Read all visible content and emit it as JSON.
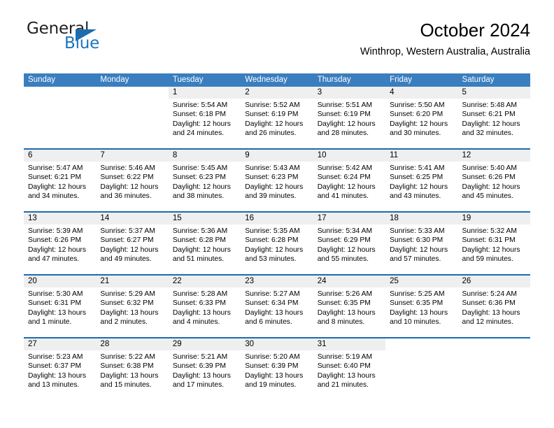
{
  "brand": {
    "name_part1": "General",
    "name_part2": "Blue",
    "icon": "triangle-logo-icon",
    "color_dark": "#231f20",
    "color_blue": "#1b75bb"
  },
  "header": {
    "title": "October 2024",
    "subtitle": "Winthrop, Western Australia, Australia"
  },
  "theme": {
    "header_blue": "#3a7ebf",
    "rule_blue": "#1b6cb0",
    "day_band_gray": "#efefef"
  },
  "weekdays": [
    "Sunday",
    "Monday",
    "Tuesday",
    "Wednesday",
    "Thursday",
    "Friday",
    "Saturday"
  ],
  "weeks": [
    [
      {
        "day": "",
        "sunrise": "",
        "sunset": "",
        "daylight": "",
        "empty": true
      },
      {
        "day": "",
        "sunrise": "",
        "sunset": "",
        "daylight": "",
        "empty": true
      },
      {
        "day": "1",
        "sunrise": "Sunrise: 5:54 AM",
        "sunset": "Sunset: 6:18 PM",
        "daylight": "Daylight: 12 hours and 24 minutes."
      },
      {
        "day": "2",
        "sunrise": "Sunrise: 5:52 AM",
        "sunset": "Sunset: 6:19 PM",
        "daylight": "Daylight: 12 hours and 26 minutes."
      },
      {
        "day": "3",
        "sunrise": "Sunrise: 5:51 AM",
        "sunset": "Sunset: 6:19 PM",
        "daylight": "Daylight: 12 hours and 28 minutes."
      },
      {
        "day": "4",
        "sunrise": "Sunrise: 5:50 AM",
        "sunset": "Sunset: 6:20 PM",
        "daylight": "Daylight: 12 hours and 30 minutes."
      },
      {
        "day": "5",
        "sunrise": "Sunrise: 5:48 AM",
        "sunset": "Sunset: 6:21 PM",
        "daylight": "Daylight: 12 hours and 32 minutes."
      }
    ],
    [
      {
        "day": "6",
        "sunrise": "Sunrise: 5:47 AM",
        "sunset": "Sunset: 6:21 PM",
        "daylight": "Daylight: 12 hours and 34 minutes."
      },
      {
        "day": "7",
        "sunrise": "Sunrise: 5:46 AM",
        "sunset": "Sunset: 6:22 PM",
        "daylight": "Daylight: 12 hours and 36 minutes."
      },
      {
        "day": "8",
        "sunrise": "Sunrise: 5:45 AM",
        "sunset": "Sunset: 6:23 PM",
        "daylight": "Daylight: 12 hours and 38 minutes."
      },
      {
        "day": "9",
        "sunrise": "Sunrise: 5:43 AM",
        "sunset": "Sunset: 6:23 PM",
        "daylight": "Daylight: 12 hours and 39 minutes."
      },
      {
        "day": "10",
        "sunrise": "Sunrise: 5:42 AM",
        "sunset": "Sunset: 6:24 PM",
        "daylight": "Daylight: 12 hours and 41 minutes."
      },
      {
        "day": "11",
        "sunrise": "Sunrise: 5:41 AM",
        "sunset": "Sunset: 6:25 PM",
        "daylight": "Daylight: 12 hours and 43 minutes."
      },
      {
        "day": "12",
        "sunrise": "Sunrise: 5:40 AM",
        "sunset": "Sunset: 6:26 PM",
        "daylight": "Daylight: 12 hours and 45 minutes."
      }
    ],
    [
      {
        "day": "13",
        "sunrise": "Sunrise: 5:39 AM",
        "sunset": "Sunset: 6:26 PM",
        "daylight": "Daylight: 12 hours and 47 minutes."
      },
      {
        "day": "14",
        "sunrise": "Sunrise: 5:37 AM",
        "sunset": "Sunset: 6:27 PM",
        "daylight": "Daylight: 12 hours and 49 minutes."
      },
      {
        "day": "15",
        "sunrise": "Sunrise: 5:36 AM",
        "sunset": "Sunset: 6:28 PM",
        "daylight": "Daylight: 12 hours and 51 minutes."
      },
      {
        "day": "16",
        "sunrise": "Sunrise: 5:35 AM",
        "sunset": "Sunset: 6:28 PM",
        "daylight": "Daylight: 12 hours and 53 minutes."
      },
      {
        "day": "17",
        "sunrise": "Sunrise: 5:34 AM",
        "sunset": "Sunset: 6:29 PM",
        "daylight": "Daylight: 12 hours and 55 minutes."
      },
      {
        "day": "18",
        "sunrise": "Sunrise: 5:33 AM",
        "sunset": "Sunset: 6:30 PM",
        "daylight": "Daylight: 12 hours and 57 minutes."
      },
      {
        "day": "19",
        "sunrise": "Sunrise: 5:32 AM",
        "sunset": "Sunset: 6:31 PM",
        "daylight": "Daylight: 12 hours and 59 minutes."
      }
    ],
    [
      {
        "day": "20",
        "sunrise": "Sunrise: 5:30 AM",
        "sunset": "Sunset: 6:31 PM",
        "daylight": "Daylight: 13 hours and 1 minute."
      },
      {
        "day": "21",
        "sunrise": "Sunrise: 5:29 AM",
        "sunset": "Sunset: 6:32 PM",
        "daylight": "Daylight: 13 hours and 2 minutes."
      },
      {
        "day": "22",
        "sunrise": "Sunrise: 5:28 AM",
        "sunset": "Sunset: 6:33 PM",
        "daylight": "Daylight: 13 hours and 4 minutes."
      },
      {
        "day": "23",
        "sunrise": "Sunrise: 5:27 AM",
        "sunset": "Sunset: 6:34 PM",
        "daylight": "Daylight: 13 hours and 6 minutes."
      },
      {
        "day": "24",
        "sunrise": "Sunrise: 5:26 AM",
        "sunset": "Sunset: 6:35 PM",
        "daylight": "Daylight: 13 hours and 8 minutes."
      },
      {
        "day": "25",
        "sunrise": "Sunrise: 5:25 AM",
        "sunset": "Sunset: 6:35 PM",
        "daylight": "Daylight: 13 hours and 10 minutes."
      },
      {
        "day": "26",
        "sunrise": "Sunrise: 5:24 AM",
        "sunset": "Sunset: 6:36 PM",
        "daylight": "Daylight: 13 hours and 12 minutes."
      }
    ],
    [
      {
        "day": "27",
        "sunrise": "Sunrise: 5:23 AM",
        "sunset": "Sunset: 6:37 PM",
        "daylight": "Daylight: 13 hours and 13 minutes."
      },
      {
        "day": "28",
        "sunrise": "Sunrise: 5:22 AM",
        "sunset": "Sunset: 6:38 PM",
        "daylight": "Daylight: 13 hours and 15 minutes."
      },
      {
        "day": "29",
        "sunrise": "Sunrise: 5:21 AM",
        "sunset": "Sunset: 6:39 PM",
        "daylight": "Daylight: 13 hours and 17 minutes."
      },
      {
        "day": "30",
        "sunrise": "Sunrise: 5:20 AM",
        "sunset": "Sunset: 6:39 PM",
        "daylight": "Daylight: 13 hours and 19 minutes."
      },
      {
        "day": "31",
        "sunrise": "Sunrise: 5:19 AM",
        "sunset": "Sunset: 6:40 PM",
        "daylight": "Daylight: 13 hours and 21 minutes."
      },
      {
        "day": "",
        "sunrise": "",
        "sunset": "",
        "daylight": "",
        "empty": true
      },
      {
        "day": "",
        "sunrise": "",
        "sunset": "",
        "daylight": "",
        "empty": true
      }
    ]
  ]
}
